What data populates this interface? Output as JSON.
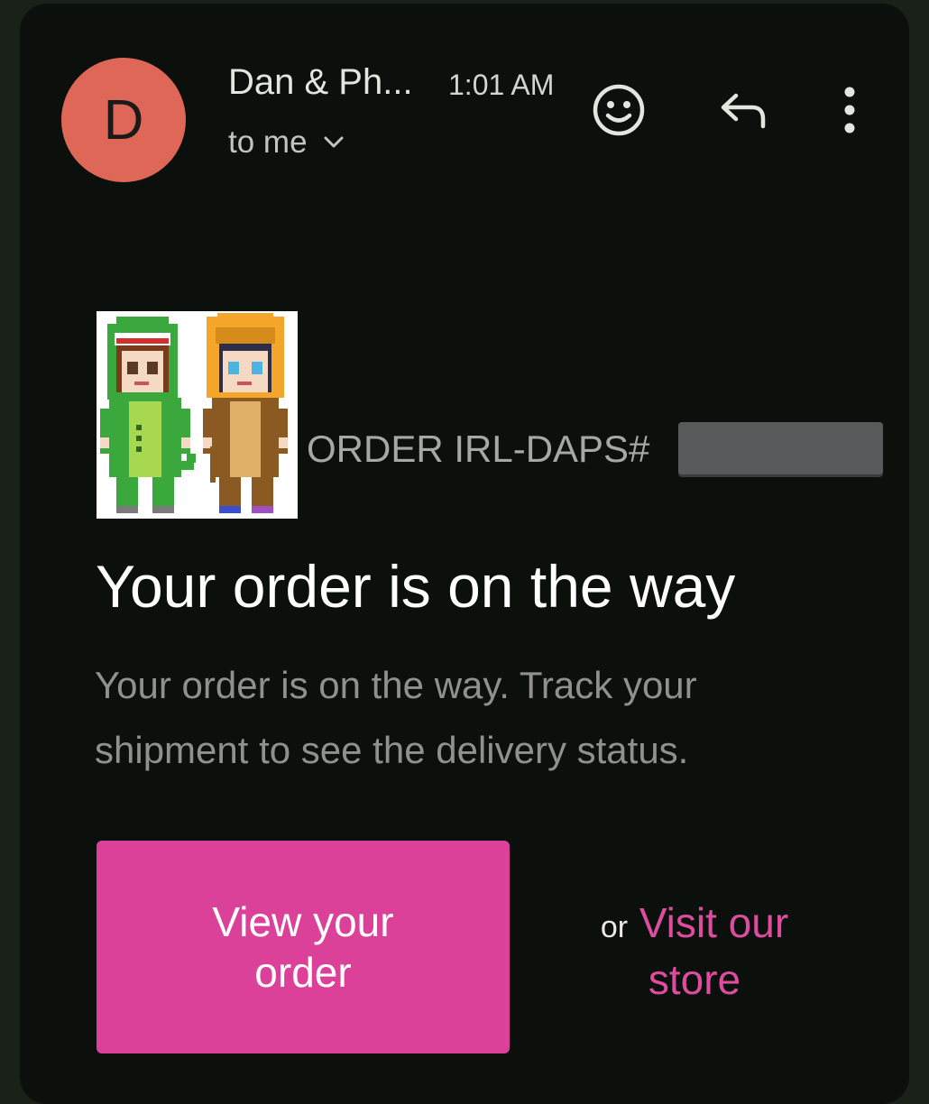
{
  "header": {
    "avatar_letter": "D",
    "sender": "Dan & Ph...",
    "time": "1:01 AM",
    "recipient": "to me"
  },
  "icons": {
    "react": "smiley-icon",
    "reply": "reply-arrow-icon",
    "more": "vertical-dots-icon",
    "expand": "chevron-down-icon"
  },
  "email": {
    "order_label": "ORDER IRL-DAPS#",
    "headline": "Your order is on the way",
    "description": "Your order is on the way. Track your shipment to see the delivery status.",
    "button_label": "View your order",
    "or_text": "or",
    "store_link": "Visit our store"
  },
  "colors": {
    "avatar": "#df6757",
    "button": "#dc4199",
    "link": "#de4c9f",
    "background": "#0c100c"
  }
}
